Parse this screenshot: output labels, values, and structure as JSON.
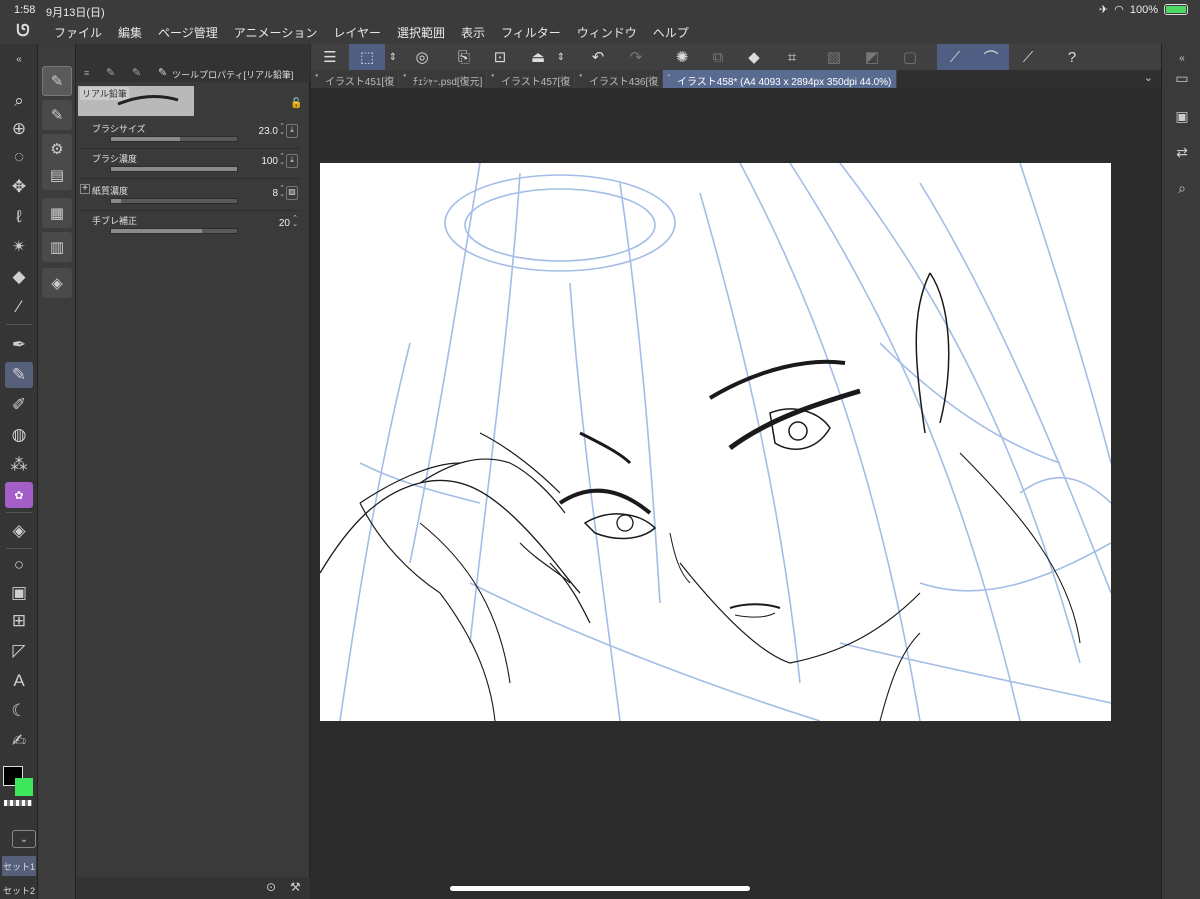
{
  "status": {
    "time": "1:58",
    "date": "9月13日(日)",
    "battery": "100%"
  },
  "menu": [
    "ファイル",
    "編集",
    "ページ管理",
    "アニメーション",
    "レイヤー",
    "選択範囲",
    "表示",
    "フィルター",
    "ウィンドウ",
    "ヘルプ"
  ],
  "tool_property": {
    "title": "ツールプロパティ[リアル鉛筆]",
    "brush_name": "リアル鉛筆",
    "rows": [
      {
        "label": "ブラシサイズ",
        "value": "23.0",
        "fraction": 0.55
      },
      {
        "label": "ブラシ濃度",
        "value": "100",
        "fraction": 1.0
      },
      {
        "label": "紙質濃度",
        "value": "8",
        "fraction": 0.08
      },
      {
        "label": "手ブレ補正",
        "value": "20",
        "fraction": 0.72
      }
    ]
  },
  "tabs": [
    {
      "label": "イラスト451[復"
    },
    {
      "label": "ﾁｪｼｬｰ.psd[復元]"
    },
    {
      "label": "イラスト457[復"
    },
    {
      "label": "イラスト436[復"
    },
    {
      "label": "イラスト458* (A4 4093 x 2894px 350dpi 44.0%)"
    }
  ],
  "sets": [
    "セット1",
    "セット2"
  ],
  "colors": {
    "main": "#000000",
    "sub": "#3de65a",
    "accent": "#5a6b92"
  },
  "icons": {
    "tools": [
      "zoom-icon",
      "move-layer-icon",
      "select-icon",
      "move-icon",
      "lasso-icon",
      "magic-wand-icon",
      "fill-icon",
      "eyedropper-icon",
      "pen-icon",
      "pencil-icon",
      "brush-icon",
      "blend-icon",
      "airbrush-icon",
      "decoration-icon",
      "eraser-icon",
      "shape-icon",
      "gradient-icon",
      "frame-icon",
      "ruler-icon",
      "text-icon",
      "balloon-icon",
      "correct-line-icon"
    ]
  }
}
